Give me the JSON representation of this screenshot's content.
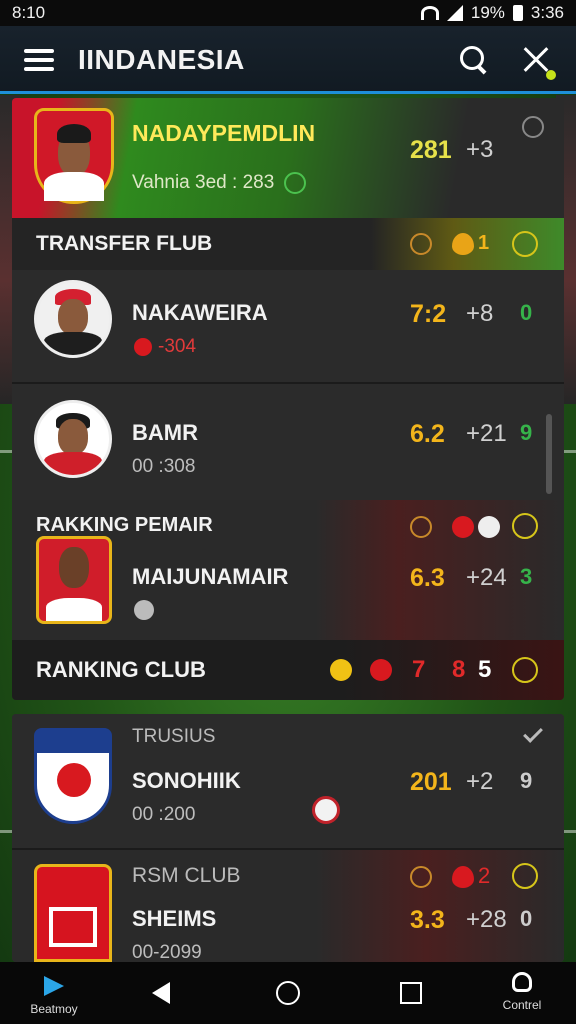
{
  "status_bar": {
    "time": "8:10",
    "battery": "19%",
    "clock": "3:36"
  },
  "app_bar": {
    "title": "IINDANESIA"
  },
  "featured": {
    "name": "NADAYPEMDLIN",
    "subtitle": "Vahnia 3ed : 283",
    "score": "281",
    "delta": "+3"
  },
  "transfer_header": {
    "label": "TRANSFER FLUB",
    "count": "1"
  },
  "players": [
    {
      "name": "NAKAWEIRA",
      "sub": "-304",
      "score": "7:2",
      "delta": "+8",
      "third": "0"
    },
    {
      "name": "BAMR",
      "sub": "00 :308",
      "score": "6.2",
      "delta": "+21",
      "third": "9"
    }
  ],
  "ranking_pemair": {
    "label": "RAKKING PEMAIR",
    "name": "MAIJUNAMAIR",
    "score": "6.3",
    "delta": "+24",
    "third": "3"
  },
  "ranking_club": {
    "label": "RANKING CLUB",
    "num1": "7",
    "num2": "8",
    "num3": "5"
  },
  "clubs": [
    {
      "header": "TRUSIUS",
      "name": "SONOHIIK",
      "sub": "00 :200",
      "score": "201",
      "delta": "+2",
      "third": "9"
    },
    {
      "header": "RSM CLUB",
      "name": "SHEIMS",
      "sub": "00-2099",
      "score": "3.3",
      "delta": "+28",
      "third": "0",
      "count": "2"
    }
  ],
  "nav": {
    "left_label": "Beatmoy",
    "right_label": "Contrel"
  },
  "colors": {
    "accent_blue": "#1e8fd8",
    "score_gold": "#f3b51b",
    "positive_green": "#36b34a",
    "red": "#d8191f"
  }
}
